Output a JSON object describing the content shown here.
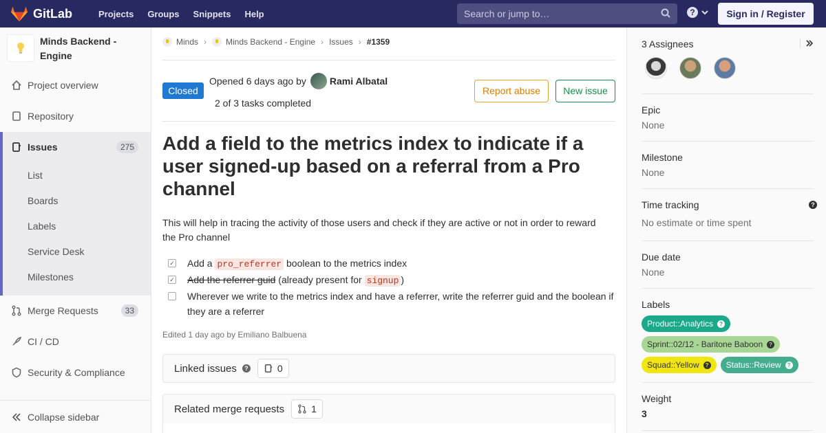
{
  "navbar": {
    "brand": "GitLab",
    "links": [
      "Projects",
      "Groups",
      "Snippets",
      "Help"
    ],
    "search_placeholder": "Search or jump to…",
    "signin": "Sign in / Register"
  },
  "sidebar": {
    "project_name": "Minds Backend - Engine",
    "items": [
      {
        "label": "Project overview",
        "icon": "home-icon"
      },
      {
        "label": "Repository",
        "icon": "doc-icon"
      },
      {
        "label": "Issues",
        "icon": "issues-icon",
        "count": "275"
      },
      {
        "label": "Merge Requests",
        "icon": "merge-request-icon",
        "count": "33"
      },
      {
        "label": "CI / CD",
        "icon": "rocket-icon"
      },
      {
        "label": "Security & Compliance",
        "icon": "shield-icon"
      }
    ],
    "issues_sub": [
      "List",
      "Boards",
      "Labels",
      "Service Desk",
      "Milestones"
    ],
    "collapse": "Collapse sidebar"
  },
  "breadcrumb": [
    "Minds",
    "Minds Backend - Engine",
    "Issues",
    "#1359"
  ],
  "issue": {
    "status": "Closed",
    "opened_prefix": "Opened 6 days ago by",
    "author": "Rami Albatal",
    "tasks_status": "2 of 3 tasks completed",
    "report_abuse": "Report abuse",
    "new_issue": "New issue",
    "title": "Add a field to the metrics index to indicate if a user signed-up based on a referral from a Pro channel",
    "description": "This will help in tracing the activity of those users and check if they are active or not in order to reward the Pro channel",
    "tasks": [
      {
        "checked": true,
        "pre": "Add a",
        "code": "pro_referrer",
        "post": "boolean to the metrics index"
      },
      {
        "checked": true,
        "strike": "Add the referrer guid",
        "pre": "(already present for",
        "code": "signup",
        "post": ")"
      },
      {
        "checked": false,
        "text": "Wherever we write to the metrics index and have a referrer, write the referrer guid and the boolean if they are a referrer"
      }
    ],
    "edited": "Edited 1 day ago by Emiliano Balbuena",
    "linked_issues_label": "Linked issues",
    "linked_issues_count": "0",
    "related_mr_label": "Related merge requests",
    "related_mr_count": "1"
  },
  "right_sidebar": {
    "assignees_title": "3 Assignees",
    "epic_title": "Epic",
    "epic_value": "None",
    "milestone_title": "Milestone",
    "milestone_value": "None",
    "time_title": "Time tracking",
    "time_value": "No estimate or time spent",
    "due_title": "Due date",
    "due_value": "None",
    "labels_title": "Labels",
    "labels": [
      {
        "text": "Product::Analytics",
        "bg": "#1aaa8a",
        "fg": "#ffffff"
      },
      {
        "text": "Sprint::02/12 - Baritone Baboon",
        "bg": "#a8d695",
        "fg": "#333333"
      },
      {
        "text": "Squad::Yellow",
        "bg": "#f1e612",
        "fg": "#333333"
      },
      {
        "text": "Status::Review",
        "bg": "#44ad8e",
        "fg": "#ffffff"
      }
    ],
    "weight_title": "Weight",
    "weight_value": "3"
  }
}
